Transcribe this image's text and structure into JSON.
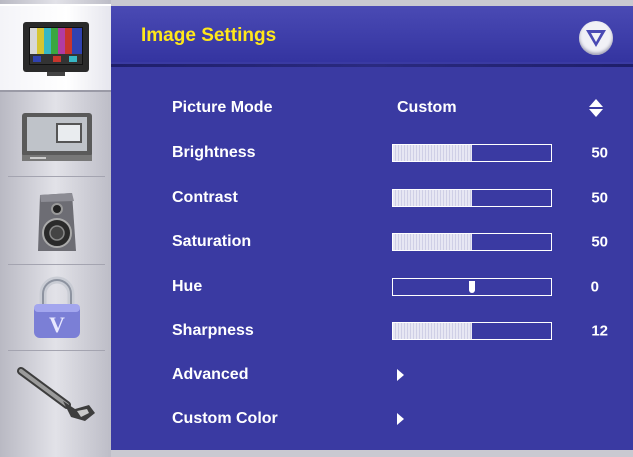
{
  "header": {
    "title": "Image Settings",
    "brand_logo_letter": "V"
  },
  "sidebar": {
    "items": [
      {
        "icon": "tv-color-bars-icon",
        "active": true
      },
      {
        "icon": "picture-in-picture-monitor-icon",
        "active": false
      },
      {
        "icon": "speaker-icon",
        "active": false
      },
      {
        "icon": "padlock-icon",
        "active": false
      },
      {
        "icon": "wrench-icon",
        "active": false
      }
    ]
  },
  "menu": {
    "picture_mode": {
      "label": "Picture Mode",
      "value": "Custom"
    },
    "brightness": {
      "label": "Brightness",
      "value": "50",
      "level_percent": 50
    },
    "contrast": {
      "label": "Contrast",
      "value": "50",
      "level_percent": 50
    },
    "saturation": {
      "label": "Saturation",
      "value": "50",
      "level_percent": 50
    },
    "hue": {
      "label": "Hue",
      "value": "0",
      "level_percent": 50
    },
    "sharpness": {
      "label": "Sharpness",
      "value": "12",
      "level_percent": 50
    },
    "advanced": {
      "label": "Advanced"
    },
    "custom_color": {
      "label": "Custom Color"
    }
  },
  "colors": {
    "panel_bg": "#3a3aa2",
    "title_yellow": "#ffe81a",
    "text_white": "#ffffff",
    "sidebar_gray": "#c9c9d1"
  }
}
